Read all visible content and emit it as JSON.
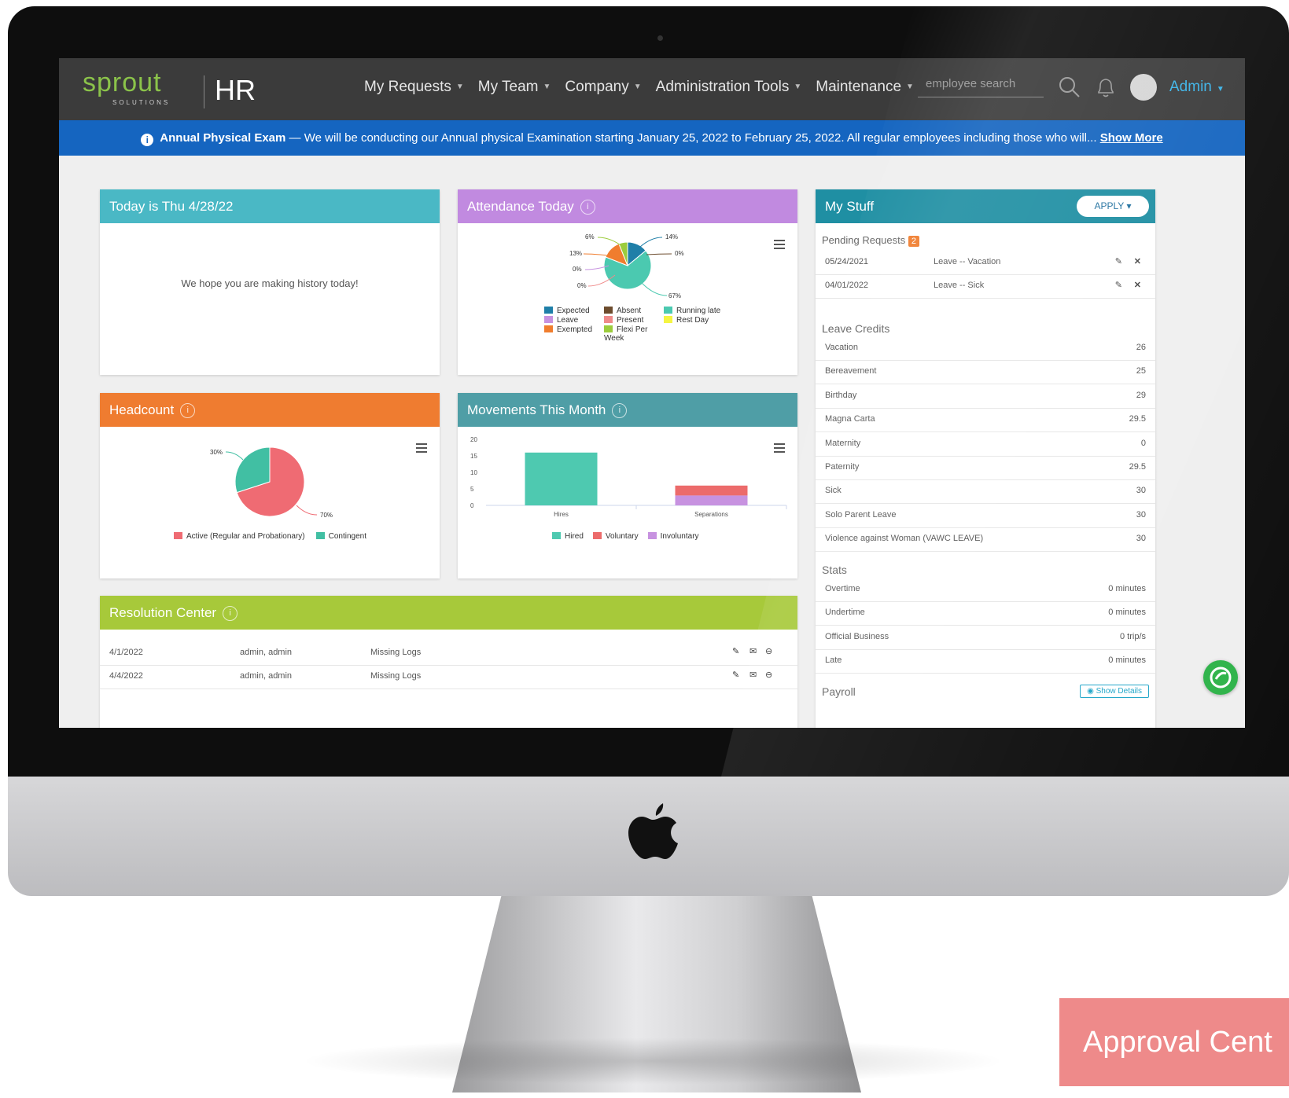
{
  "nav": {
    "logo_word": "sprout",
    "logo_sub": "SOLUTIONS",
    "logo_hr": "HR",
    "menu": [
      "My Requests",
      "My Team",
      "Company",
      "Administration Tools",
      "Maintenance"
    ],
    "search_placeholder": "employee search",
    "user": "Admin"
  },
  "banner": {
    "title": "Annual Physical Exam",
    "text": " — We will be conducting our Annual physical Examination starting January 25, 2022 to February 25, 2022. All regular employees including those who will... ",
    "link": "Show More"
  },
  "today": {
    "title": "Today is Thu 4/28/22",
    "message": "We hope you are making history today!"
  },
  "attendance": {
    "title": "Attendance Today",
    "labels": [
      "6%",
      "14%",
      "13%",
      "0%",
      "0%",
      "0%",
      "67%"
    ],
    "legend": [
      {
        "name": "Expected",
        "color": "#1f7fa8"
      },
      {
        "name": "Absent",
        "color": "#6d4c2e"
      },
      {
        "name": "Running late",
        "color": "#4bc9b0"
      },
      {
        "name": "Leave",
        "color": "#c792e0"
      },
      {
        "name": "Present",
        "color": "#ef8a8a"
      },
      {
        "name": "Rest Day",
        "color": "#f5f542"
      },
      {
        "name": "Exempted",
        "color": "#f07d2e"
      },
      {
        "name": "Flexi Per Week",
        "color": "#9ccc3c"
      }
    ]
  },
  "headcount": {
    "title": "Headcount",
    "labels": [
      "30%",
      "70%"
    ],
    "legend": [
      {
        "name": "Active (Regular and Probationary)",
        "color": "#ef6b73"
      },
      {
        "name": "Contingent",
        "color": "#41bfa3"
      }
    ]
  },
  "movements": {
    "title": "Movements This Month",
    "yticks": [
      "20",
      "15",
      "10",
      "5",
      "0"
    ],
    "categories": [
      "Hires",
      "Separations"
    ],
    "legend": [
      {
        "name": "Hired",
        "color": "#4ec9b0"
      },
      {
        "name": "Voluntary",
        "color": "#ec6b6b"
      },
      {
        "name": "Involuntary",
        "color": "#c792e0"
      }
    ]
  },
  "resolution": {
    "title": "Resolution Center",
    "rows": [
      {
        "date": "4/1/2022",
        "name": "admin, admin",
        "type": "Missing Logs"
      },
      {
        "date": "4/4/2022",
        "name": "admin, admin",
        "type": "Missing Logs"
      }
    ]
  },
  "mystuff": {
    "title": "My Stuff",
    "apply": "APPLY",
    "pending_label": "Pending Requests",
    "pending_count": "2",
    "pending": [
      {
        "date": "05/24/2021",
        "type": "Leave -- Vacation"
      },
      {
        "date": "04/01/2022",
        "type": "Leave -- Sick"
      }
    ],
    "leave_label": "Leave Credits",
    "leave": [
      {
        "name": "Vacation",
        "value": "26"
      },
      {
        "name": "Bereavement",
        "value": "25"
      },
      {
        "name": "Birthday",
        "value": "29"
      },
      {
        "name": "Magna Carta",
        "value": "29.5"
      },
      {
        "name": "Maternity",
        "value": "0"
      },
      {
        "name": "Paternity",
        "value": "29.5"
      },
      {
        "name": "Sick",
        "value": "30"
      },
      {
        "name": "Solo Parent Leave",
        "value": "30"
      },
      {
        "name": "Violence against Woman (VAWC LEAVE)",
        "value": "30"
      }
    ],
    "stats_label": "Stats",
    "stats": [
      {
        "name": "Overtime",
        "value": "0 minutes"
      },
      {
        "name": "Undertime",
        "value": "0 minutes"
      },
      {
        "name": "Official Business",
        "value": "0 trip/s"
      },
      {
        "name": "Late",
        "value": "0 minutes"
      }
    ],
    "payroll_label": "Payroll",
    "show_details": "Show Details"
  },
  "approval_label": "Approval Cent",
  "chart_data": [
    {
      "type": "pie",
      "title": "Attendance Today",
      "categories": [
        "Expected",
        "Absent",
        "Running late",
        "Leave",
        "Present",
        "Rest Day",
        "Exempted",
        "Flexi Per Week"
      ],
      "values": [
        14,
        0,
        67,
        0,
        0,
        0,
        13,
        6
      ]
    },
    {
      "type": "pie",
      "title": "Headcount",
      "categories": [
        "Active (Regular and Probationary)",
        "Contingent"
      ],
      "values": [
        70,
        30
      ]
    },
    {
      "type": "bar",
      "title": "Movements This Month",
      "categories": [
        "Hires",
        "Separations"
      ],
      "series": [
        {
          "name": "Hired",
          "values": [
            16,
            0
          ]
        },
        {
          "name": "Voluntary",
          "values": [
            0,
            3
          ]
        },
        {
          "name": "Involuntary",
          "values": [
            0,
            3
          ]
        }
      ],
      "ylim": [
        0,
        20
      ]
    }
  ]
}
